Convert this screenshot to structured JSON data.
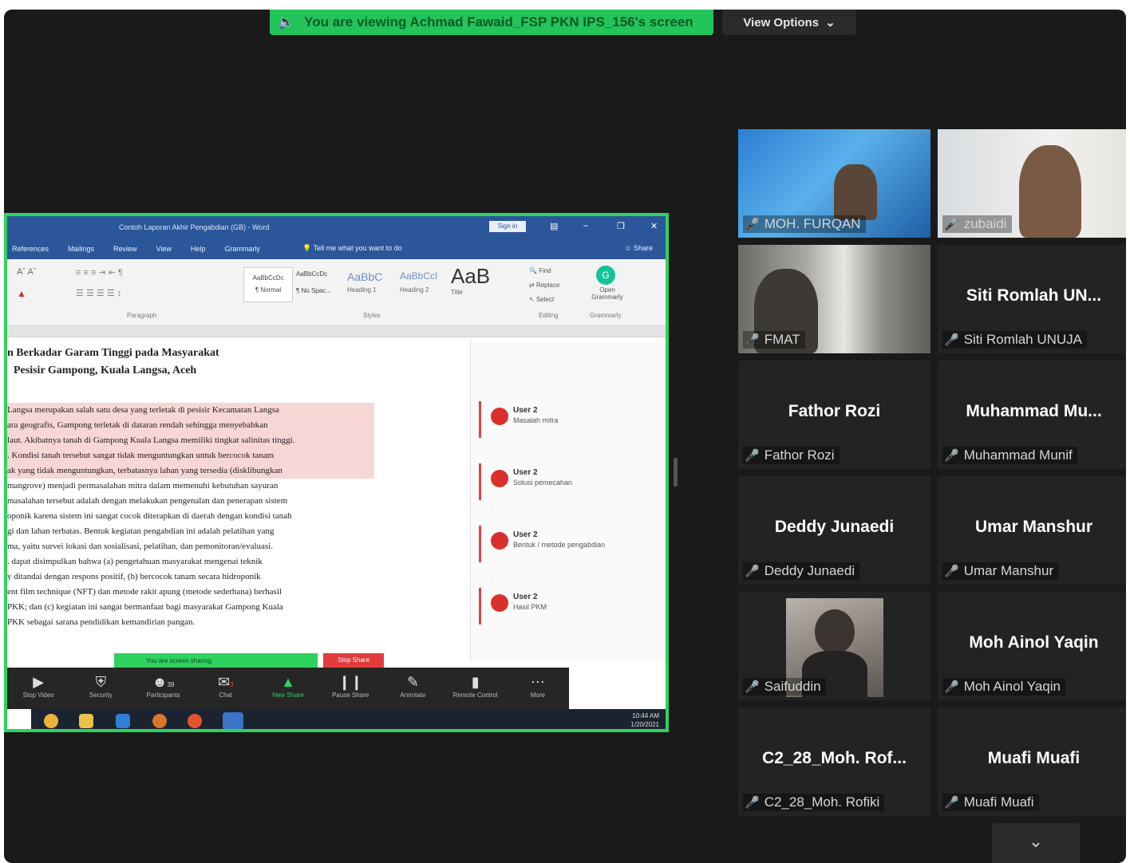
{
  "banner": {
    "sharing_text": "You are viewing Achmad Fawaid_FSP PKN IPS_156's screen",
    "view_options": "View Options"
  },
  "word": {
    "window_title": "Contoh Laporan Akhir Pengabdian (GB) - Word",
    "sign_in": "Sign in",
    "menu": [
      "References",
      "Mailings",
      "Review",
      "View",
      "Help",
      "Grammarly"
    ],
    "tell_me": "Tell me what you want to do",
    "share": "Share",
    "styles": [
      "AaBbCcDc",
      "AaBbCcDc",
      "AaBbC",
      "AaBbCcI",
      "AaB"
    ],
    "style_names": [
      "¶ Normal",
      "¶ No Spac...",
      "Heading 1",
      "Heading 2",
      "Title"
    ],
    "group_labels": [
      "Paragraph",
      "Styles",
      "Editing",
      "Grammarly"
    ],
    "editing": [
      "Find",
      "Replace",
      "Select"
    ],
    "grammarly_label": "Open Grammarly"
  },
  "document": {
    "title_line1": "n Berkadar Garam Tinggi pada Masyarakat",
    "title_line2": "Pesisir Gampong, Kuala Langsa, Aceh",
    "lines": [
      "Langsa merupakan salah satu desa yang terletak di pesisir Kecamatan Langsa",
      "ara geografis, Gampong terletak di dataran rendah sehingga menyebabkan",
      "laut. Akibatnya tanah di Gampong Kuala Langsa memiliki tingkat salinitas tinggi.",
      ". Kondisi tanah tersebut sangat tidak menguntungkan untuk bercocok tanam",
      "ak yang tidak menguntungkan, terbatasnya lahan yang tersedia (disklibungkan",
      "mangrove) menjadi permasalahan mitra dalam memenuhi kebutuhan sayuran",
      "masalahan tersebut adalah dengan melakukan pengenalan dan penerapan sistem",
      "oponik karena sistem ini sangat cocok diterapkan di daerah dengan kondisi tanah",
      "gi dan lahan terbatas. Bentuk kegiatan pengabdian ini adalah pelatihan yang",
      "ma, yaitu survei lokasi dan sosialisasi, pelatihan, dan pemonitoran/evaluasi.",
      ". dapat disimpulkan bahwa (a) pengetahuan masyarakat mengenai teknik",
      "y ditandai dengan respons positif, (b) bercocok tanam secara hidroponik",
      "ent film technique (NFT) dan metode rakit apung (metode sederhana) berhasil",
      "PKK; dan (c) kegiatan ini sangat bermanfaat bagi masyarakat Gampong Kuala",
      "PKK sebagai sarana pendidikan kemandirian pangan."
    ],
    "comments": [
      {
        "user": "User 2",
        "text": "Masalah mitra"
      },
      {
        "user": "User 2",
        "text": "Solusi pemecahan"
      },
      {
        "user": "User 2",
        "text": "Bentuk / metode pengabdian"
      },
      {
        "user": "User 2",
        "text": "Hasil PKM"
      }
    ]
  },
  "share_controls": {
    "sharing_pill": "You are screen sharing",
    "stop_share": "Stop Share"
  },
  "zoom_toolbar": {
    "buttons": [
      "Stop Video",
      "Security",
      "Participants",
      "Chat",
      "New Share",
      "Pause Share",
      "Annotate",
      "Remote Control",
      "More"
    ],
    "participant_count": "39",
    "chat_badge": "3"
  },
  "taskbar": {
    "time": "10:44 AM",
    "date": "1/20/2021"
  },
  "participants": [
    {
      "big": "",
      "small": "MOH. FURQAN",
      "video": true
    },
    {
      "big": "",
      "small": "zubaidi",
      "video": true
    },
    {
      "big": "",
      "small": "FMAT",
      "video": true
    },
    {
      "big": "Siti Romlah UN...",
      "small": "Siti Romlah UNUJA",
      "video": false
    },
    {
      "big": "Fathor Rozi",
      "small": "Fathor Rozi",
      "video": false
    },
    {
      "big": "Muhammad  Mu...",
      "small": "Muhammad Munif",
      "video": false
    },
    {
      "big": "Deddy Junaedi",
      "small": "Deddy Junaedi",
      "video": false
    },
    {
      "big": "Umar Manshur",
      "small": "Umar Manshur",
      "video": false
    },
    {
      "big": "",
      "small": "Saifuddin",
      "video": true
    },
    {
      "big": "Moh Ainol Yaqin",
      "small": "Moh Ainol Yaqin",
      "video": false
    },
    {
      "big": "C2_28_Moh. Rof...",
      "small": "C2_28_Moh. Rofiki",
      "video": false
    },
    {
      "big": "Muafi Muafi",
      "small": "Muafi Muafi",
      "video": false
    }
  ],
  "colors": {
    "share_green": "#23c45a",
    "word_blue": "#2b579a",
    "muted_red": "#e8453c"
  }
}
